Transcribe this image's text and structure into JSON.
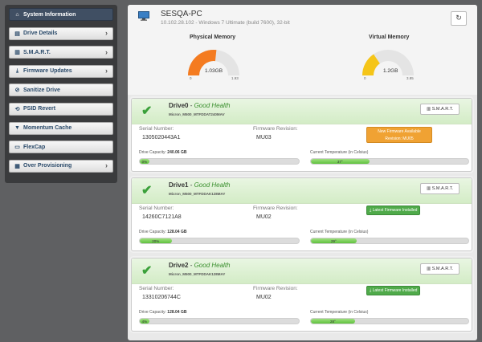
{
  "sidebar": {
    "items": [
      {
        "label": "System Information",
        "icon": "home-icon",
        "glyph": "⌂",
        "active": true,
        "chevron": false
      },
      {
        "label": "Drive Details",
        "icon": "list-icon",
        "glyph": "▤",
        "chevron": true
      },
      {
        "label": "S.M.A.R.T.",
        "icon": "chart-icon",
        "glyph": "▥",
        "chevron": true
      },
      {
        "label": "Firmware Updates",
        "icon": "download-icon",
        "glyph": "⤓",
        "chevron": true
      },
      {
        "label": "Sanitize Drive",
        "icon": "block-icon",
        "glyph": "⊘",
        "chevron": false
      },
      {
        "label": "PSID Revert",
        "icon": "refresh-icon",
        "glyph": "⟲",
        "chevron": false
      },
      {
        "label": "Momentum Cache",
        "icon": "filter-icon",
        "glyph": "▼",
        "chevron": false
      },
      {
        "label": "FlexCap",
        "icon": "document-icon",
        "glyph": "▭",
        "chevron": false
      },
      {
        "label": "Over Provisioning",
        "icon": "grid-icon",
        "glyph": "▦",
        "chevron": true
      }
    ],
    "chevron_glyph": "›"
  },
  "system": {
    "pc_name": "SESQA-PC",
    "pc_detail": "10.102.28.102 - Windows 7 Ultimate (build 7600), 32-bit",
    "refresh_glyph": "↻"
  },
  "memory": {
    "physical": {
      "title": "Physical Memory",
      "value": "1.03GB",
      "min": "0",
      "max": "1.93",
      "fraction": 0.534,
      "color": "#f47b20"
    },
    "virtual": {
      "title": "Virtual Memory",
      "value": "1.2GB",
      "min": "0",
      "max": "3.85",
      "fraction": 0.31,
      "color": "#f5c518"
    }
  },
  "labels": {
    "serial": "Serial Number:",
    "firmware": "Firmware Revision:",
    "capacity": "Drive Capacity:",
    "temp": "Current Temperature (in Celsius)",
    "smart": "S.M.A.R.T.",
    "smart_glyph": "▥",
    "good_health": "Good Health",
    "check_glyph": "✔"
  },
  "drives": [
    {
      "name": "Drive0",
      "model": "Micron_M500_MTFDDAT240MAV",
      "serial": "1305020443A1",
      "firmware": "MU03",
      "fw_status": "New Firmware Available\nRevision: MU05",
      "fw_type": "orange",
      "capacity": "240.06 GB",
      "cap_pct": "0%",
      "cap_frac": 0.04,
      "temp": "37°",
      "temp_frac": 0.37
    },
    {
      "name": "Drive1",
      "model": "Micron_M500_MTFDDAK128MAY",
      "serial": "14260C7121A8",
      "firmware": "MU02",
      "fw_status": "⤓ Latest Firmware Installed",
      "fw_type": "green",
      "capacity": "128.04 GB",
      "cap_pct": "20%",
      "cap_frac": 0.2,
      "temp": "29°",
      "temp_frac": 0.29
    },
    {
      "name": "Drive2",
      "model": "Micron_M500_MTFDDAK128MAY",
      "serial": "13310206744C",
      "firmware": "MU02",
      "fw_status": "⤓ Latest Firmware Installed",
      "fw_type": "green",
      "capacity": "128.04 GB",
      "cap_pct": "4%",
      "cap_frac": 0.04,
      "temp": "28°",
      "temp_frac": 0.28
    }
  ]
}
